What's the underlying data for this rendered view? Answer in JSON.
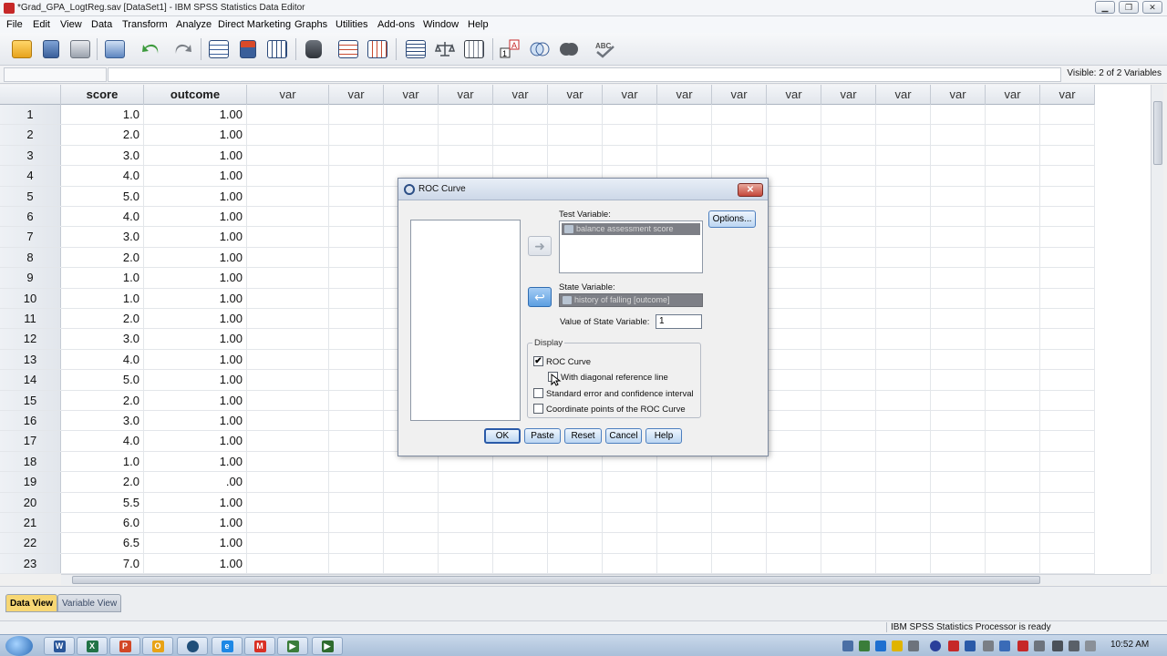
{
  "window": {
    "title": "*Grad_GPA_LogtReg.sav [DataSet1] - IBM SPSS Statistics Data Editor",
    "minimize_glyph": "▁",
    "restore_glyph": "❐",
    "close_glyph": "✕"
  },
  "menu": [
    "File",
    "Edit",
    "View",
    "Data",
    "Transform",
    "Analyze",
    "Direct Marketing",
    "Graphs",
    "Utilities",
    "Add-ons",
    "Window",
    "Help"
  ],
  "toolbar_icons": [
    "open-icon",
    "save-icon",
    "print-icon",
    "recall-dialog-icon",
    "undo-icon",
    "redo-icon",
    "goto-case-icon",
    "goto-variable-icon",
    "variables-icon",
    "find-icon",
    "insert-cases-icon",
    "insert-variable-icon",
    "split-file-icon",
    "weight-cases-icon",
    "select-cases-icon",
    "value-labels-icon",
    "use-sets-icon",
    "show-all-variables-icon",
    "spell-check-icon"
  ],
  "editbar": {
    "visible_text": "Visible: 2 of 2 Variables"
  },
  "grid": {
    "columns": [
      "score",
      "outcome",
      "var",
      "var",
      "var",
      "var",
      "var",
      "var",
      "var",
      "var",
      "var",
      "var",
      "var",
      "var",
      "var",
      "var",
      "var"
    ],
    "rows": [
      {
        "n": "1",
        "score": "1.0",
        "outcome": "1.00"
      },
      {
        "n": "2",
        "score": "2.0",
        "outcome": "1.00"
      },
      {
        "n": "3",
        "score": "3.0",
        "outcome": "1.00"
      },
      {
        "n": "4",
        "score": "4.0",
        "outcome": "1.00"
      },
      {
        "n": "5",
        "score": "5.0",
        "outcome": "1.00"
      },
      {
        "n": "6",
        "score": "4.0",
        "outcome": "1.00"
      },
      {
        "n": "7",
        "score": "3.0",
        "outcome": "1.00"
      },
      {
        "n": "8",
        "score": "2.0",
        "outcome": "1.00"
      },
      {
        "n": "9",
        "score": "1.0",
        "outcome": "1.00"
      },
      {
        "n": "10",
        "score": "1.0",
        "outcome": "1.00"
      },
      {
        "n": "11",
        "score": "2.0",
        "outcome": "1.00"
      },
      {
        "n": "12",
        "score": "3.0",
        "outcome": "1.00"
      },
      {
        "n": "13",
        "score": "4.0",
        "outcome": "1.00"
      },
      {
        "n": "14",
        "score": "5.0",
        "outcome": "1.00"
      },
      {
        "n": "15",
        "score": "2.0",
        "outcome": "1.00"
      },
      {
        "n": "16",
        "score": "3.0",
        "outcome": "1.00"
      },
      {
        "n": "17",
        "score": "4.0",
        "outcome": "1.00"
      },
      {
        "n": "18",
        "score": "1.0",
        "outcome": "1.00"
      },
      {
        "n": "19",
        "score": "2.0",
        "outcome": ".00"
      },
      {
        "n": "20",
        "score": "5.5",
        "outcome": "1.00"
      },
      {
        "n": "21",
        "score": "6.0",
        "outcome": "1.00"
      },
      {
        "n": "22",
        "score": "6.5",
        "outcome": "1.00"
      },
      {
        "n": "23",
        "score": "7.0",
        "outcome": "1.00"
      }
    ]
  },
  "view_tabs": {
    "data_view": "Data View",
    "variable_view": "Variable View"
  },
  "status": {
    "processor": "IBM SPSS Statistics Processor is ready"
  },
  "taskbar": {
    "apps": [
      "word-icon",
      "excel-icon",
      "powerpoint-icon",
      "outlook-icon",
      "spss-icon",
      "internet-explorer-icon",
      "gmail-icon",
      "camtasia-icon",
      "camtasia-recorder-icon"
    ],
    "clock": "10:52 AM"
  },
  "dialog": {
    "title": "ROC Curve",
    "close_glyph": "✕",
    "move_right_glyph": "➜",
    "move_left_glyph": "↩",
    "test_variable_label": "Test Variable:",
    "test_variable_value": "balance assessment score",
    "state_variable_label": "State Variable:",
    "state_variable_value": "history of falling [outcome]",
    "value_of_state_label": "Value of State Variable:",
    "value_of_state_value": "1",
    "options_button": "Options...",
    "display_group": "Display",
    "checkboxes": [
      {
        "label": "ROC Curve",
        "checked": true,
        "glyph": "✔"
      },
      {
        "label": "With diagonal reference line",
        "checked": false,
        "glyph": ""
      },
      {
        "label": "Standard error and confidence interval",
        "checked": false,
        "glyph": ""
      },
      {
        "label": "Coordinate points of the ROC Curve",
        "checked": false,
        "glyph": ""
      }
    ],
    "buttons": {
      "ok": "OK",
      "paste": "Paste",
      "reset": "Reset",
      "cancel": "Cancel",
      "help": "Help"
    }
  }
}
